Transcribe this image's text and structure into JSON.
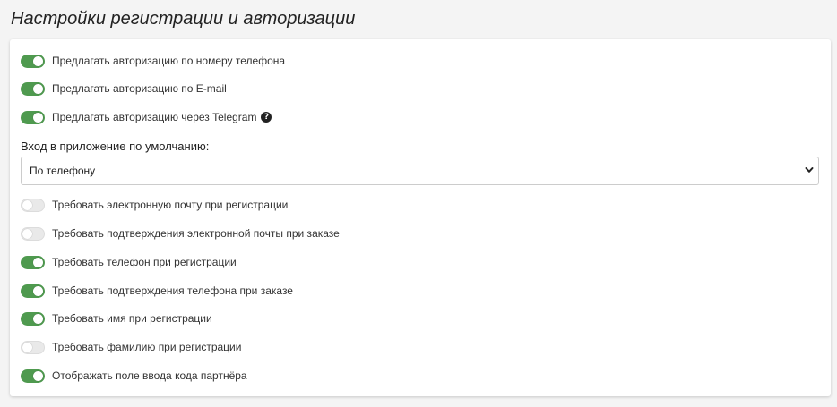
{
  "page": {
    "title": "Настройки регистрации и авторизации"
  },
  "settings": {
    "toggles_top": [
      {
        "label": "Предлагать авторизацию по номеру телефона",
        "enabled": true
      },
      {
        "label": "Предлагать авторизацию по E-mail",
        "enabled": true
      },
      {
        "label": "Предлагать авторизацию через Telegram",
        "enabled": true,
        "help_icon": "question-circle-icon"
      }
    ],
    "default_login": {
      "label": "Вход в приложение по умолчанию:",
      "value": "По телефону",
      "icon": "chevron-down-icon"
    },
    "toggles_bottom": [
      {
        "label": "Требовать электронную почту при регистрации",
        "enabled": false
      },
      {
        "label": "Требовать подтверждения электронной почты при заказе",
        "enabled": false
      },
      {
        "label": "Требовать телефон при регистрации",
        "enabled": true
      },
      {
        "label": "Требовать подтверждения телефона при заказе",
        "enabled": true
      },
      {
        "label": "Требовать имя при регистрации",
        "enabled": true
      },
      {
        "label": "Требовать фамилию при регистрации",
        "enabled": false
      },
      {
        "label": "Отображать поле ввода кода партнёра",
        "enabled": true
      }
    ]
  },
  "colors": {
    "toggle_on": "#4f9a4f",
    "toggle_off": "#e9e9e9"
  }
}
